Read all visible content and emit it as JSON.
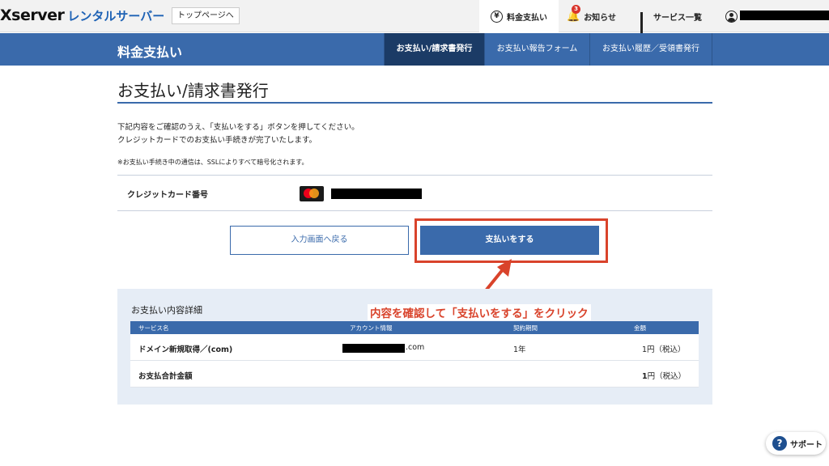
{
  "header": {
    "logo_main": "Xserver",
    "logo_sub": "レンタルサーバー",
    "top_link": "トップページへ",
    "nav": [
      {
        "label": "料金支払い",
        "icon": "yen-icon"
      },
      {
        "label": "お知らせ",
        "icon": "bell-icon",
        "badge": "3"
      },
      {
        "label": "サービス一覧",
        "icon": "grid-icon"
      }
    ],
    "account_icon": "user-icon"
  },
  "subheader": {
    "title": "料金支払い",
    "tabs": [
      {
        "label": "お支払い/請求書発行",
        "active": true
      },
      {
        "label": "お支払い報告フォーム",
        "active": false
      },
      {
        "label": "お支払い履歴／受領書発行",
        "active": false
      }
    ]
  },
  "main": {
    "title": "お支払い/請求書発行",
    "desc_line1": "下記内容をご確認のうえ、「支払いをする」ボタンを押してください。",
    "desc_line2": "クレジットカードでのお支払い手続きが完了いたします。",
    "note": "※お支払い手続き中の通信は、SSLによりすべて暗号化されます。",
    "card_label": "クレジットカード番号",
    "card_icon": "mastercard-icon",
    "back_button": "入力画面へ戻る",
    "pay_button": "支払いをする"
  },
  "annotation": {
    "text": "内容を確認して「支払いをする」をクリック",
    "color": "#d9432b"
  },
  "details": {
    "title": "お支払い内容詳細",
    "columns": [
      "サービス名",
      "アカウント情報",
      "契約期間",
      "金額"
    ],
    "rows": [
      {
        "service": "ドメイン新規取得／(com)",
        "account_suffix": ".com",
        "period": "1年",
        "amount": "1円（税込）"
      }
    ],
    "total_label": "お支払合計金額",
    "total_amount_num": "1",
    "total_amount_unit": "円（税込）"
  },
  "support": {
    "label": "サポート",
    "icon": "question-icon"
  },
  "colors": {
    "brand_blue": "#3a6aab",
    "active_tab": "#1b3b66",
    "highlight_red": "#d9432b"
  }
}
